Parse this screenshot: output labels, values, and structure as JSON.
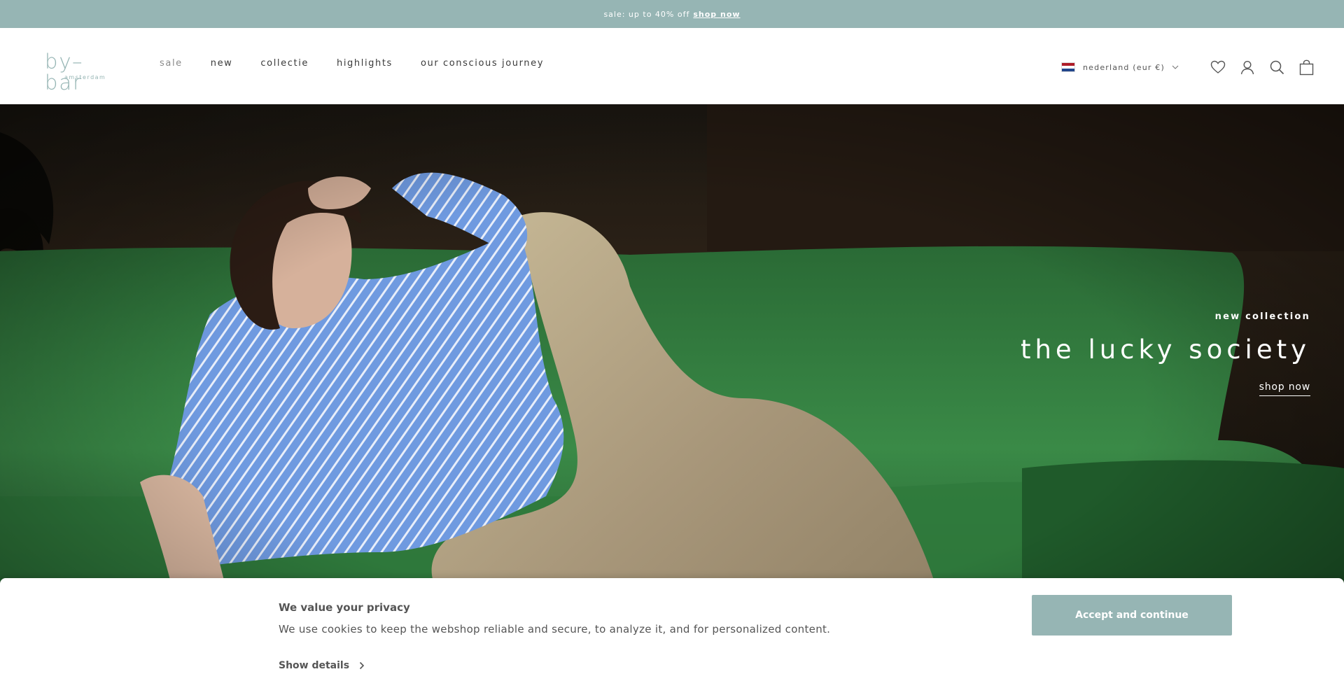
{
  "announcement": {
    "text": "sale: up to 40% off",
    "link": "shop now"
  },
  "brand": {
    "name": "by–bar",
    "sub": "amsterdam"
  },
  "nav": {
    "items": [
      {
        "label": "sale"
      },
      {
        "label": "new"
      },
      {
        "label": "collectie"
      },
      {
        "label": "highlights"
      },
      {
        "label": "our conscious journey"
      }
    ]
  },
  "tools": {
    "country_label": "nederland (eur €)",
    "icons": [
      "heart-icon",
      "account-icon",
      "search-icon",
      "bag-icon"
    ]
  },
  "hero": {
    "eyebrow": "new collection",
    "title": "the lucky society",
    "cta": "shop now"
  },
  "cookie": {
    "title": "We value your privacy",
    "text": "We use cookies to keep the webshop reliable and secure, to analyze it, and for personalized content.",
    "details": "Show details",
    "accept": "Accept and continue"
  },
  "colors": {
    "accent": "#96b5b4",
    "sofa": "#2f7a3c",
    "shirt": "#6f9ae0",
    "trousers": "#b8a888"
  }
}
